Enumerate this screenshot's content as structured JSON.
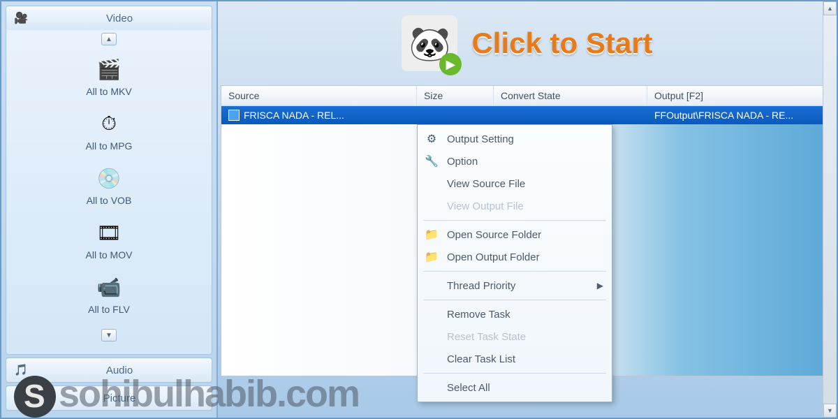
{
  "sidebar": {
    "video": {
      "title": "Video",
      "items": [
        {
          "label": "All to MKV",
          "icon": "🎬"
        },
        {
          "label": "All to MPG",
          "icon": "⏱"
        },
        {
          "label": "All to VOB",
          "icon": "💿"
        },
        {
          "label": "All to MOV",
          "icon": "🎞"
        },
        {
          "label": "All to FLV",
          "icon": "📹"
        }
      ]
    },
    "audio": {
      "title": "Audio",
      "icon": "🎵"
    },
    "picture": {
      "title": "Picture",
      "icon": "🖼"
    }
  },
  "hero": {
    "text": "Click to Start"
  },
  "table": {
    "headers": {
      "source": "Source",
      "size": "Size",
      "state": "Convert State",
      "output": "Output [F2]"
    },
    "row": {
      "source": "FRISCA NADA - REL...",
      "size": "",
      "state": "",
      "output": "FFOutput\\FRISCA NADA - RE..."
    }
  },
  "context_menu": {
    "items": [
      {
        "label": "Output Setting",
        "icon": "⚙",
        "disabled": false
      },
      {
        "label": "Option",
        "icon": "🔧",
        "disabled": false
      },
      {
        "label": "View Source File",
        "icon": "",
        "disabled": false
      },
      {
        "label": "View Output File",
        "icon": "",
        "disabled": true
      },
      {
        "sep": true
      },
      {
        "label": "Open Source Folder",
        "icon": "📁",
        "disabled": false
      },
      {
        "label": "Open Output Folder",
        "icon": "📁",
        "disabled": false
      },
      {
        "sep": true
      },
      {
        "label": "Thread Priority",
        "icon": "",
        "disabled": false,
        "submenu": true
      },
      {
        "sep": true
      },
      {
        "label": "Remove Task",
        "icon": "",
        "disabled": false
      },
      {
        "label": "Reset Task State",
        "icon": "",
        "disabled": true
      },
      {
        "label": "Clear Task List",
        "icon": "",
        "disabled": false
      },
      {
        "sep": true
      },
      {
        "label": "Select All",
        "icon": "",
        "disabled": false
      }
    ]
  },
  "watermark": "sohibulhabib.com"
}
